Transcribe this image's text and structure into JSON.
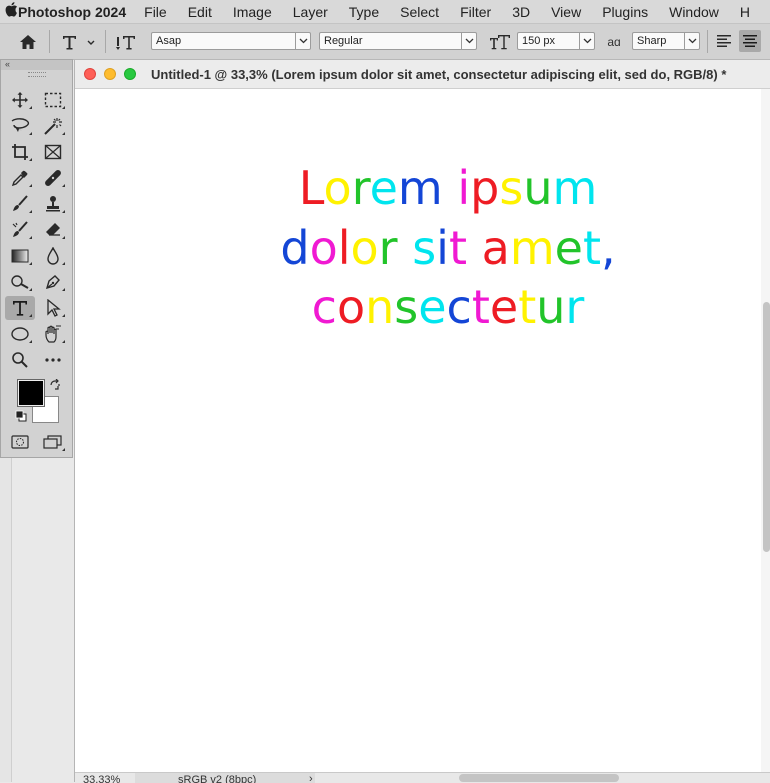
{
  "menubar": {
    "app": "Photoshop 2024",
    "items": [
      "File",
      "Edit",
      "Image",
      "Layer",
      "Type",
      "Select",
      "Filter",
      "3D",
      "View",
      "Plugins",
      "Window",
      "H"
    ]
  },
  "options_bar": {
    "font_family": "Asap",
    "font_style": "Regular",
    "font_size": "150 px",
    "aa_label": "aɑ",
    "antialias": "Sharp"
  },
  "document": {
    "title": "Untitled-1 @ 33,3% (Lorem ipsum dolor sit amet, consectetur adipiscing elit, sed do, RGB/8) *",
    "text_lines": [
      [
        {
          "t": "L",
          "c": "#ee1c24"
        },
        {
          "t": "o",
          "c": "#fff200"
        },
        {
          "t": "r",
          "c": "#22c42a"
        },
        {
          "t": "e",
          "c": "#00e5ee"
        },
        {
          "t": "m",
          "c": "#1446d6"
        },
        {
          "t": " ",
          "c": "#000000"
        },
        {
          "t": "i",
          "c": "#f019d2"
        },
        {
          "t": "p",
          "c": "#ee1c24"
        },
        {
          "t": "s",
          "c": "#fff200"
        },
        {
          "t": "u",
          "c": "#22c42a"
        },
        {
          "t": "m",
          "c": "#00e5ee"
        }
      ],
      [
        {
          "t": "d",
          "c": "#1446d6"
        },
        {
          "t": "o",
          "c": "#f019d2"
        },
        {
          "t": "l",
          "c": "#ee1c24"
        },
        {
          "t": "o",
          "c": "#fff200"
        },
        {
          "t": "r",
          "c": "#22c42a"
        },
        {
          "t": " ",
          "c": "#000000"
        },
        {
          "t": "s",
          "c": "#00e5ee"
        },
        {
          "t": "i",
          "c": "#1446d6"
        },
        {
          "t": "t",
          "c": "#f019d2"
        },
        {
          "t": " ",
          "c": "#000000"
        },
        {
          "t": "a",
          "c": "#ee1c24"
        },
        {
          "t": "m",
          "c": "#fff200"
        },
        {
          "t": "e",
          "c": "#22c42a"
        },
        {
          "t": "t",
          "c": "#00e5ee"
        },
        {
          "t": ",",
          "c": "#1446d6"
        }
      ],
      [
        {
          "t": "c",
          "c": "#f019d2"
        },
        {
          "t": "o",
          "c": "#ee1c24"
        },
        {
          "t": "n",
          "c": "#fff200"
        },
        {
          "t": "s",
          "c": "#22c42a"
        },
        {
          "t": "e",
          "c": "#00e5ee"
        },
        {
          "t": "c",
          "c": "#1446d6"
        },
        {
          "t": "t",
          "c": "#f019d2"
        },
        {
          "t": "e",
          "c": "#ee1c24"
        },
        {
          "t": "t",
          "c": "#fff200"
        },
        {
          "t": "u",
          "c": "#22c42a"
        },
        {
          "t": "r",
          "c": "#00e5ee"
        }
      ]
    ]
  },
  "status": {
    "zoom": "33,33%",
    "profile": "sRGB v2 (8bpc)"
  },
  "tools": [
    "move-tool",
    "marquee-tool",
    "lasso-tool",
    "magic-wand-tool",
    "crop-tool",
    "frame-tool",
    "eyedropper-tool",
    "healing-brush-tool",
    "brush-tool",
    "clone-stamp-tool",
    "history-brush-tool",
    "eraser-tool",
    "gradient-tool",
    "blur-tool",
    "dodge-tool",
    "pen-tool",
    "type-tool",
    "path-selection-tool",
    "ellipse-tool",
    "hand-tool",
    "zoom-tool",
    "more-tools"
  ],
  "colors": {
    "foreground": "#000000",
    "background": "#ffffff",
    "close_light": "#fe5f57",
    "minimize_light": "#febc2e",
    "zoom_light": "#28c840"
  }
}
